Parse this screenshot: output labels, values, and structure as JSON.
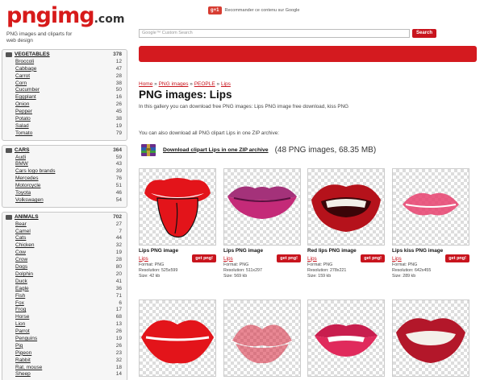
{
  "site": {
    "logo_main": "pngimg",
    "logo_tld": ".com",
    "tagline": "PNG images and cliparts for web design",
    "gplus_label": "g+1",
    "gplus_text": "Recommander ce contenu sur Google",
    "search_placeholder": "Google™ Custom Search",
    "search_button": "Search"
  },
  "sidebar": {
    "categories": [
      {
        "name": "VEGETABLES",
        "count": "378",
        "items": [
          {
            "name": "Broccoli",
            "count": "12"
          },
          {
            "name": "Cabbage",
            "count": "47"
          },
          {
            "name": "Carrot",
            "count": "28"
          },
          {
            "name": "Corn",
            "count": "38"
          },
          {
            "name": "Cucumber",
            "count": "50"
          },
          {
            "name": "Eggplant",
            "count": "16"
          },
          {
            "name": "Onion",
            "count": "26"
          },
          {
            "name": "Pepper",
            "count": "45"
          },
          {
            "name": "Potato",
            "count": "38"
          },
          {
            "name": "Salad",
            "count": "19"
          },
          {
            "name": "Tomato",
            "count": "79"
          }
        ]
      },
      {
        "name": "CARS",
        "count": "364",
        "items": [
          {
            "name": "Audi",
            "count": "59"
          },
          {
            "name": "BMW",
            "count": "43"
          },
          {
            "name": "Cars logo brands",
            "count": "39"
          },
          {
            "name": "Mercedes",
            "count": "76"
          },
          {
            "name": "Motorcycle",
            "count": "51"
          },
          {
            "name": "Toyota",
            "count": "46"
          },
          {
            "name": "Volkswagen",
            "count": "54"
          }
        ]
      },
      {
        "name": "ANIMALS",
        "count": "702",
        "items": [
          {
            "name": "Bear",
            "count": "27"
          },
          {
            "name": "Camel",
            "count": "7"
          },
          {
            "name": "Cats",
            "count": "44"
          },
          {
            "name": "Chicken",
            "count": "32"
          },
          {
            "name": "Cow",
            "count": "19"
          },
          {
            "name": "Crow",
            "count": "28"
          },
          {
            "name": "Dogs",
            "count": "80"
          },
          {
            "name": "Dolphin",
            "count": "20"
          },
          {
            "name": "Duck",
            "count": "41"
          },
          {
            "name": "Eagle",
            "count": "36"
          },
          {
            "name": "Fish",
            "count": "71"
          },
          {
            "name": "Fox",
            "count": "6"
          },
          {
            "name": "Frog",
            "count": "17"
          },
          {
            "name": "Horse",
            "count": "68"
          },
          {
            "name": "Lion",
            "count": "13"
          },
          {
            "name": "Parrot",
            "count": "26"
          },
          {
            "name": "Penguins",
            "count": "19"
          },
          {
            "name": "Pig",
            "count": "26"
          },
          {
            "name": "Pigeon",
            "count": "23"
          },
          {
            "name": "Rabbit",
            "count": "32"
          },
          {
            "name": "Rat, mouse",
            "count": "18"
          },
          {
            "name": "Sheep",
            "count": "14"
          }
        ]
      }
    ]
  },
  "breadcrumb": {
    "home": "Home",
    "sep": "»",
    "png_images": "PNG images",
    "people": "PEOPLE",
    "current": "Lips"
  },
  "page_title": "PNG images: Lips",
  "intro_text": "In this gallery you can download free PNG images: Lips PNG image free download, kiss PNG",
  "zip": {
    "intro": "You can also download all PNG clipart Lips in one ZIP archive:",
    "link": "Download clipart Lips in one ZIP archive",
    "meta": "(48 PNG images, 68.35 MB)"
  },
  "cards": [
    {
      "title": "Lips PNG image",
      "category": "Lips",
      "button": "get png!",
      "format": "Format: PNG",
      "resolution": "Resolution: 525x599",
      "size": "Size: 42 kb"
    },
    {
      "title": "Lips PNG image",
      "category": "Lips",
      "button": "get png!",
      "format": "Format: PNG",
      "resolution": "Resolution: 511x297",
      "size": "Size: 569 kb"
    },
    {
      "title": "Red lips PNG image",
      "category": "Lips",
      "button": "get png!",
      "format": "Format: PNG",
      "resolution": "Resolution: 278x221",
      "size": "Size: 159 kb"
    },
    {
      "title": "Lips kiss PNG image",
      "category": "Lips",
      "button": "get png!",
      "format": "Format: PNG",
      "resolution": "Resolution: 642x455",
      "size": "Size: 289 kb"
    }
  ],
  "colors": {
    "brand_red": "#c8141d",
    "bar_red": "#d41a1f"
  }
}
